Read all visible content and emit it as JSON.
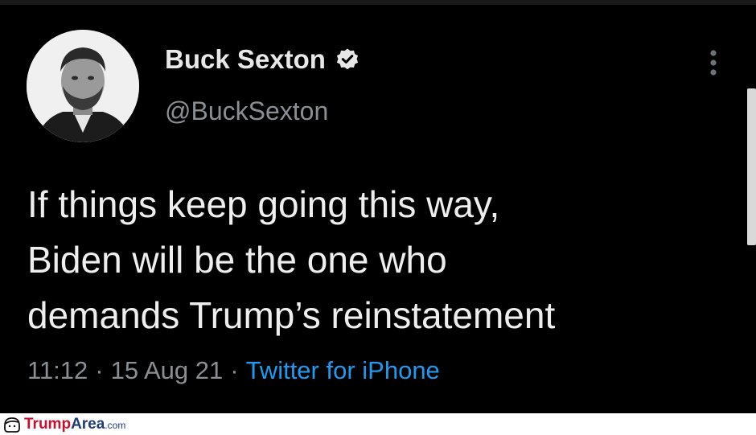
{
  "tweet": {
    "author": {
      "display_name": "Buck Sexton",
      "handle": "@BuckSexton",
      "verified_icon": "verified-badge-icon",
      "avatar_icon": "profile-photo"
    },
    "text_lines": [
      "If things keep going this way,",
      "Biden will be the one who",
      "demands Trump’s reinstatement"
    ],
    "time": "11:12",
    "separator": "·",
    "date": "15 Aug 21",
    "source": "Twitter for iPhone",
    "more_icon": "more-vertical-icon"
  },
  "watermark": {
    "part1": "Trump",
    "part2": "Area",
    "part3": ".com"
  },
  "colors": {
    "background": "#000000",
    "link": "#1d9bf0",
    "muted": "#8b8f94",
    "text": "#eeeeee",
    "watermark_red": "#c8102e",
    "watermark_blue": "#1f3b7a"
  }
}
